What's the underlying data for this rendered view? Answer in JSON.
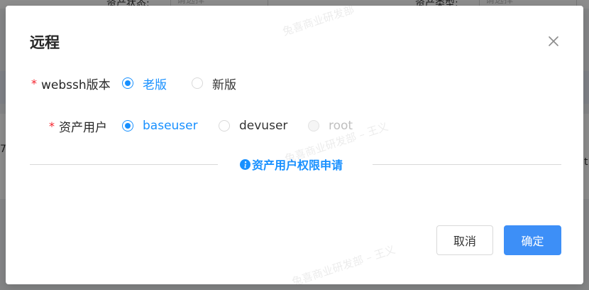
{
  "background": {
    "top_label_1": "资产状态:",
    "top_input_1_placeholder": "请选择",
    "top_label_2": "资产类型:",
    "top_input_2_placeholder": "请选择",
    "edge_left": "7",
    "edge_right": "t"
  },
  "modal": {
    "title": "远程",
    "fields": {
      "webssh_version": {
        "label": "webssh版本",
        "required_mark": "*",
        "options": [
          {
            "label": "老版",
            "checked": true
          },
          {
            "label": "新版",
            "checked": false
          }
        ]
      },
      "asset_user": {
        "label": "资产用户",
        "required_mark": "*",
        "options": [
          {
            "label": "baseuser",
            "checked": true
          },
          {
            "label": "devuser",
            "checked": false
          },
          {
            "label": "root",
            "checked": false,
            "disabled": true
          }
        ]
      }
    },
    "apply_link": "资产用户权限申请",
    "footer": {
      "cancel_label": "取消",
      "ok_label": "确定"
    }
  },
  "watermark": {
    "text_full": "兔喜商业研发部 – 王义",
    "text_partial": "兔喜商业研发部"
  },
  "colors": {
    "primary": "#1890ff",
    "button_primary": "#3d8ff7",
    "required": "#f5222d",
    "overlay": "rgba(0,0,0,0.45)"
  }
}
